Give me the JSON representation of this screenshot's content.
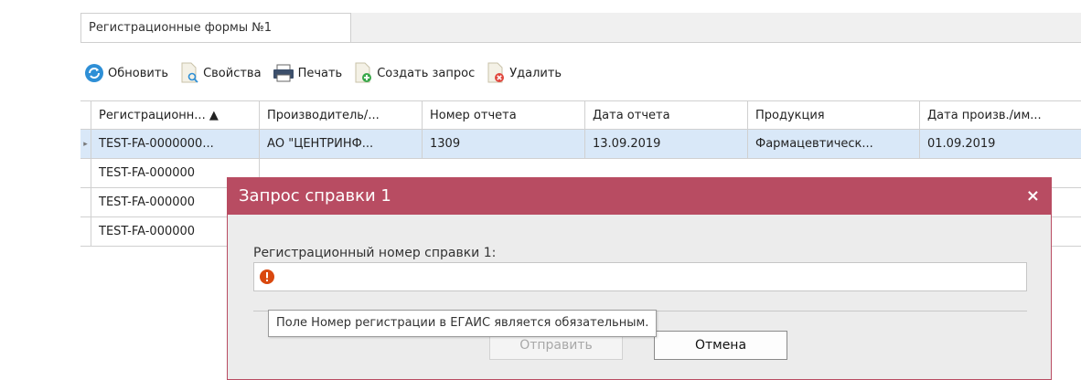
{
  "tab": {
    "label": "Регистрационные формы №1"
  },
  "toolbar": {
    "refresh": "Обновить",
    "properties": "Свойства",
    "print": "Печать",
    "create_request": "Создать запрос",
    "delete": "Удалить"
  },
  "grid": {
    "columns": [
      "Регистрационн... ▲",
      "Производитель/...",
      "Номер отчета",
      "Дата отчета",
      "Продукция",
      "Дата произв./им..."
    ],
    "rows": [
      [
        "TEST-FA-0000000...",
        "АО \"ЦЕНТРИНФ...",
        "1309",
        "13.09.2019",
        "Фармацевтическ...",
        "01.09.2019"
      ],
      [
        "TEST-FA-000000",
        "",
        "",
        "",
        "",
        ""
      ],
      [
        "TEST-FA-000000",
        "",
        "",
        "",
        "",
        ""
      ],
      [
        "TEST-FA-000000",
        "",
        "",
        "",
        "",
        ""
      ]
    ]
  },
  "dialog": {
    "title": "Запрос справки 1",
    "close": "×",
    "field_label": "Регистрационный номер справки 1:",
    "field_value": "",
    "tooltip": "Поле Номер регистрации в ЕГАИС является обязательным.",
    "send": "Отправить",
    "cancel": "Отмена"
  },
  "colors": {
    "dialog_header": "#b84c62",
    "selected_row": "#d9e8f8"
  }
}
